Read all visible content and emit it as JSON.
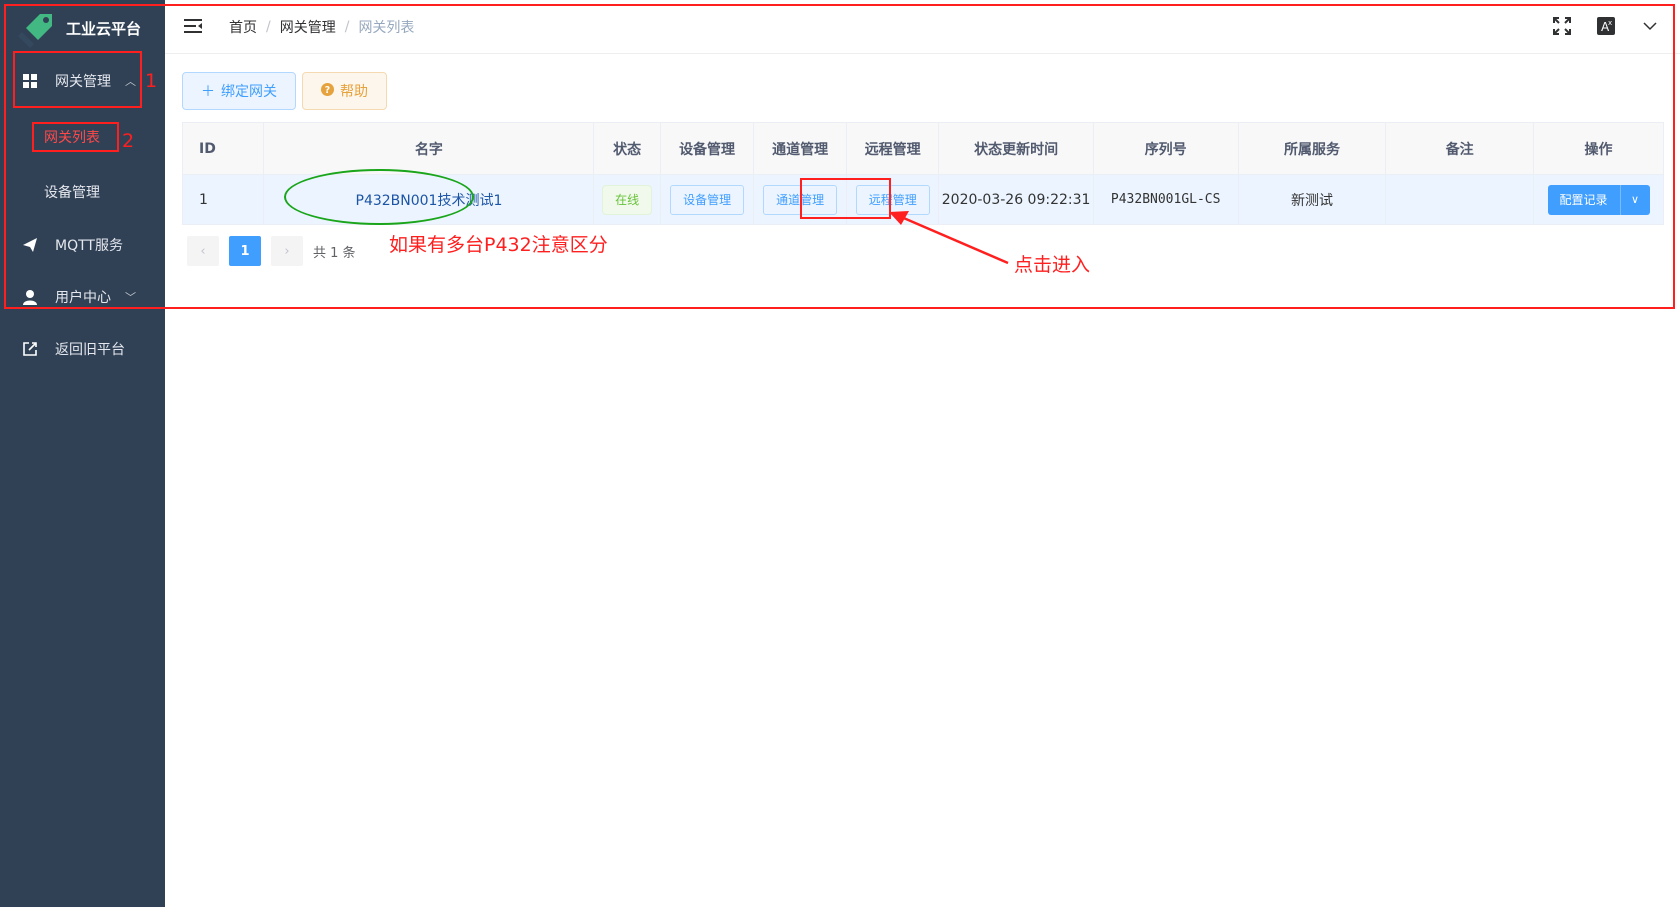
{
  "app": {
    "title": "工业云平台",
    "logo": "tag-logo"
  },
  "sidebar": {
    "items": [
      {
        "label": "网关管理",
        "icon": "grid-icon",
        "expanded": true
      },
      {
        "label": "MQTT服务",
        "icon": "send-icon"
      },
      {
        "label": "用户中心",
        "icon": "user-icon"
      },
      {
        "label": "返回旧平台",
        "icon": "external-link-icon"
      }
    ],
    "subitems": [
      {
        "label": "网关列表",
        "active": true
      },
      {
        "label": "设备管理"
      }
    ]
  },
  "header": {
    "breadcrumb": [
      "首页",
      "网关管理",
      "网关列表"
    ],
    "icons": [
      "fullscreen-icon",
      "translate-icon",
      "chevron-down-icon"
    ]
  },
  "toolbar": {
    "bind_label": "绑定网关",
    "help_label": "帮助"
  },
  "table": {
    "columns": [
      "ID",
      "名字",
      "状态",
      "设备管理",
      "通道管理",
      "远程管理",
      "状态更新时间",
      "序列号",
      "所属服务",
      "备注",
      "操作"
    ],
    "rows": [
      {
        "id": "1",
        "name": "P432BN001技术测试1",
        "status": "在线",
        "device_btn": "设备管理",
        "channel_btn": "通道管理",
        "remote_btn": "远程管理",
        "updated": "2020-03-26 09:22:31",
        "serial": "P432BN001GL-CS",
        "service": "新测试",
        "note": "",
        "action": "配置记录"
      }
    ]
  },
  "pagination": {
    "current": "1",
    "total": "共 1 条"
  },
  "annotations": {
    "label1": "1",
    "label2": "2",
    "note_multi": "如果有多台P432注意区分",
    "note_click": "点击进入",
    "color_red": "#ff1f1f",
    "color_green": "#1aa51a"
  },
  "colors": {
    "sidebar_bg": "#304156",
    "primary": "#409eff",
    "success": "#67c23a",
    "warning": "#e6a23c"
  }
}
